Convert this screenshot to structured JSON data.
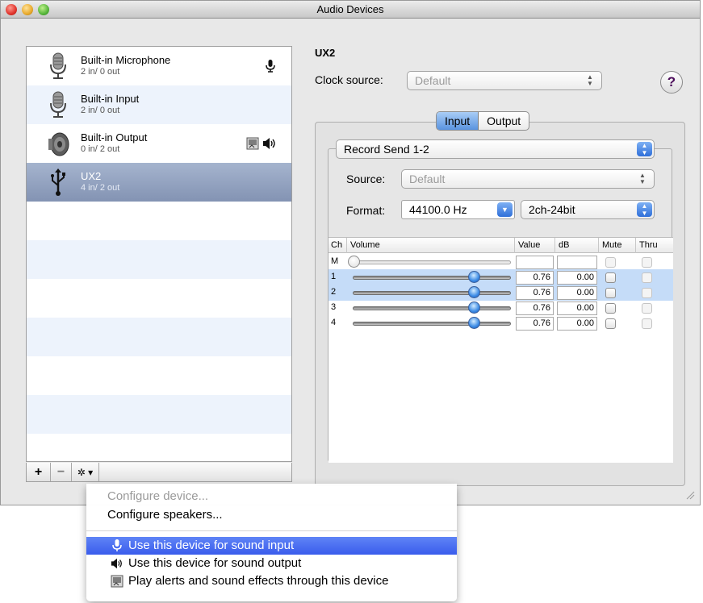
{
  "window": {
    "title": "Audio Devices"
  },
  "devices": [
    {
      "name": "Built-in Microphone",
      "io": "2 in/ 0 out",
      "icon": "microphone-icon",
      "badges": [
        "sound-input-icon"
      ]
    },
    {
      "name": "Built-in Input",
      "io": "2 in/ 0 out",
      "icon": "microphone-icon",
      "badges": []
    },
    {
      "name": "Built-in Output",
      "io": "0 in/ 2 out",
      "icon": "speaker-icon",
      "badges": [
        "alerts-icon",
        "sound-output-icon"
      ]
    },
    {
      "name": "UX2",
      "io": "4 in/ 2 out",
      "icon": "usb-icon",
      "badges": [],
      "selected": true
    }
  ],
  "list_toolbar": {
    "add": "+",
    "remove": "−",
    "action": "✲ ▾"
  },
  "detail": {
    "device_title": "UX2",
    "clock_source_label": "Clock source:",
    "clock_source_value": "Default",
    "help": "?",
    "tabs": [
      "Input",
      "Output"
    ],
    "active_tab": "Input",
    "stream": "Record Send 1-2",
    "source_label": "Source:",
    "source_value": "Default",
    "format_label": "Format:",
    "sample_rate": "44100.0 Hz",
    "channels_format": "2ch-24bit"
  },
  "channel_table": {
    "columns": [
      "Ch",
      "Volume",
      "Value",
      "dB",
      "Mute",
      "Thru"
    ],
    "rows": [
      {
        "ch": "M",
        "volume": 0.0,
        "value": "",
        "db": "",
        "mute": false,
        "thru": false,
        "enabled": false
      },
      {
        "ch": "1",
        "volume": 0.76,
        "value": "0.76",
        "db": "0.00",
        "mute": false,
        "thru": false,
        "selected": true,
        "enabled": true
      },
      {
        "ch": "2",
        "volume": 0.76,
        "value": "0.76",
        "db": "0.00",
        "mute": false,
        "thru": false,
        "selected": true,
        "enabled": true
      },
      {
        "ch": "3",
        "volume": 0.76,
        "value": "0.76",
        "db": "0.00",
        "mute": false,
        "thru": false,
        "enabled": true
      },
      {
        "ch": "4",
        "volume": 0.76,
        "value": "0.76",
        "db": "0.00",
        "mute": false,
        "thru": false,
        "enabled": true
      }
    ]
  },
  "action_menu": {
    "items": [
      {
        "label": "Configure device...",
        "disabled": true
      },
      {
        "label": "Configure speakers..."
      },
      {
        "label": "Use this device for sound input",
        "icon": "microphone-icon",
        "highlighted": true
      },
      {
        "label": "Use this device for sound output",
        "icon": "speaker-icon"
      },
      {
        "label": "Play alerts and sound effects through this device",
        "icon": "alerts-icon"
      }
    ]
  },
  "colors": {
    "selection": "#8393b3",
    "menu_highlight": "#3a5cec",
    "row_stripe": "#edf3fc",
    "table_selection": "#c5dcf8"
  }
}
